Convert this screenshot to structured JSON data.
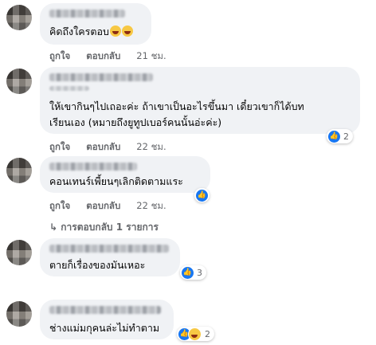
{
  "actions": {
    "like": "ถูกใจ",
    "reply": "ตอบกลับ"
  },
  "comments": [
    {
      "text": "คิดถึงใครตอบ",
      "time": "21 ชม.",
      "reactions": null
    },
    {
      "line1": "ให้เขากินๆไปเถอะค่ะ ถ้าเขาเป็นอะไรขึ้นมา เดี๋ยวเขาก็ได้บท",
      "line2": "เรียนเอง (หมายถึงยูทูปเบอร์คนนั้นอ่ะค่ะ)",
      "time": "22 ชม.",
      "reactions": "2"
    },
    {
      "text": "คอนเทนร์เพี้ยนๆเลิกติดตามแระ",
      "time": "22 ชม.",
      "reactions": ""
    },
    {
      "text": "ตายก็เรื่องของมันเหอะ",
      "reactions": "3"
    },
    {
      "text": "ช่างแม่มกุคนล่ะไม่ทำตาม",
      "reactions": "2"
    }
  ],
  "replies_link": "การตอบกลับ 1 รายการ",
  "icons": {
    "like": "thumbs-up-icon",
    "haha": "laughing-face-icon",
    "reply_arrow": "reply-arrow-icon"
  },
  "colors": {
    "bubble": "#f0f2f5",
    "like_blue": "#1877f2",
    "meta_gray": "#65676b"
  }
}
